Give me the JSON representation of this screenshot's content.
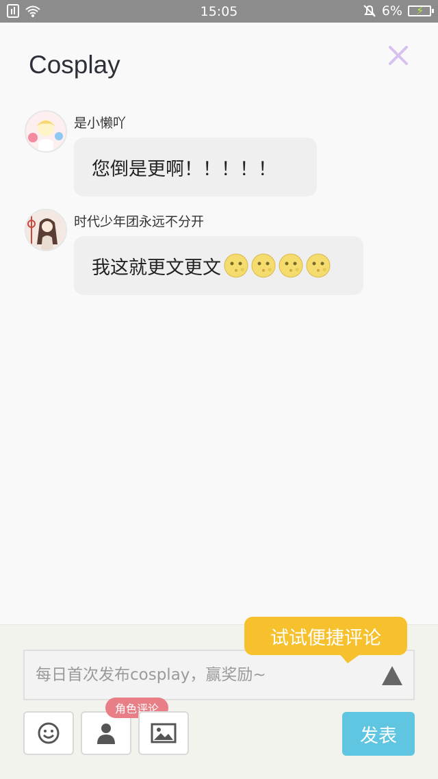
{
  "status_bar": {
    "time": "15:05",
    "battery": "6%"
  },
  "header": {
    "title": "Cosplay"
  },
  "messages": [
    {
      "username": "是小懒吖",
      "text": "您倒是更啊！！！！！"
    },
    {
      "username": "时代少年团永远不分开",
      "text": "我这就更文更文"
    }
  ],
  "composer": {
    "placeholder": "每日首次发布cosplay，赢奖励~",
    "tip": "试试便捷评论",
    "role_tag": "角色评论",
    "publish_label": "发表"
  },
  "icons": [
    "wifi-icon",
    "sim-icon",
    "mute-bell-icon",
    "battery-icon",
    "close-icon",
    "send-triangle-icon",
    "emoji-icon",
    "person-icon",
    "image-icon",
    "moon-emoji-icon"
  ],
  "colors": {
    "accent_blue": "#5fc5e0",
    "tip_yellow": "#f6c12d",
    "role_pink": "#e87f86",
    "close_purple": "#d6c1ef"
  }
}
